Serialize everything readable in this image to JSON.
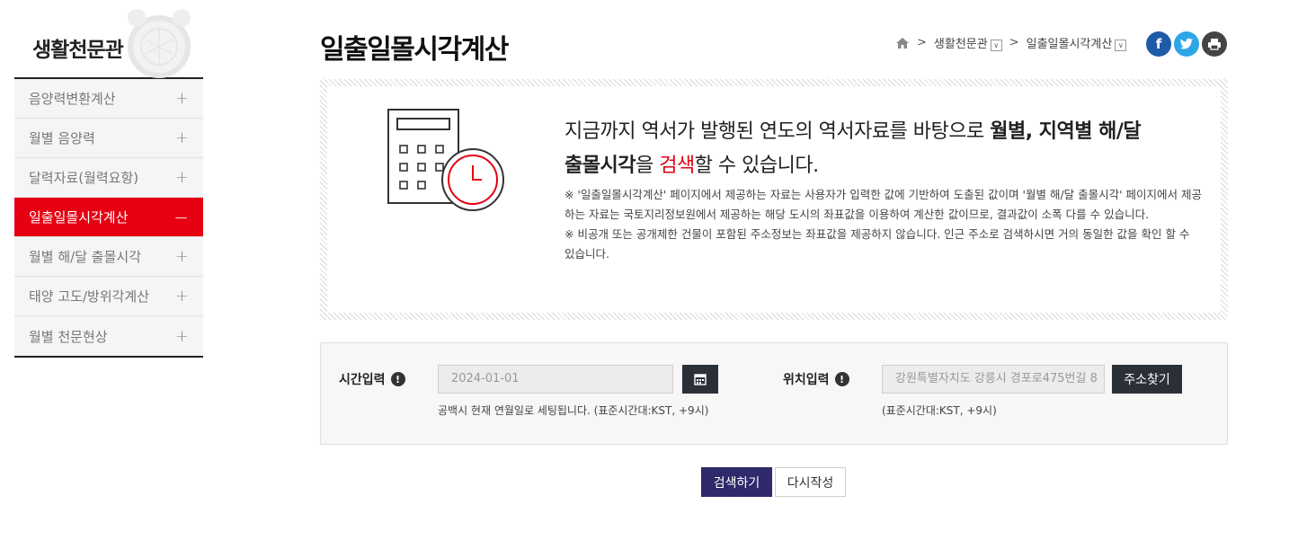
{
  "sidebar": {
    "title": "생활천문관",
    "items": [
      {
        "label": "음양력변환계산",
        "sign": "+"
      },
      {
        "label": "월별 음양력",
        "sign": "+"
      },
      {
        "label": "달력자료(월력요항)",
        "sign": "+"
      },
      {
        "label": "일출일몰시각계산",
        "sign": "−",
        "active": true
      },
      {
        "label": "월별 해/달 출몰시각",
        "sign": "+"
      },
      {
        "label": "태양 고도/방위각계산",
        "sign": "+"
      },
      {
        "label": "월별 천문현상",
        "sign": "+"
      }
    ]
  },
  "header": {
    "title": "일출일몰시각계산",
    "breadcrumb": [
      "생활천문관",
      "일출일몰시각계산"
    ],
    "social": [
      "f",
      "t",
      "print"
    ]
  },
  "info": {
    "lead_1": "지금까지 역서가 발행된 연도의 역서자료를 바탕으로 ",
    "lead_bold_1": "월별, 지역별 해/달",
    "lead_bold_2": "출몰시각",
    "lead_2": "을 ",
    "lead_red": "검색",
    "lead_3": "할 수 있습니다.",
    "note_1": "※ '일출일몰시각계산' 페이지에서 제공하는 자료는 사용자가 입력한 값에 기반하여 도출된 값이며 '월별 해/달 출몰시각' 페이지에서 제공하는 자료는 국토지리정보원에서 제공하는 해당 도시의 좌표값을 이용하여 계산한 값이므로, 결과값이 소폭 다를 수 있습니다.",
    "note_2": "※ 비공개 또는 공개제한 건물이 포함된 주소정보는 좌표값을 제공하지 않습니다. 인근 주소로 검색하시면 거의 동일한 값을 확인 할 수 있습니다."
  },
  "form": {
    "time_label": "시간입력",
    "time_value": "2024-01-01",
    "time_hint": "공백시 현재 연월일로 세팅됩니다. (표준시간대:KST, +9시)",
    "location_label": "위치입력",
    "location_value": "강원특별자치도 강릉시 경포로475번길 8",
    "location_hint": "(표준시간대:KST, +9시)",
    "address_button": "주소찾기"
  },
  "actions": {
    "search": "검색하기",
    "reset": "다시작성"
  },
  "colors": {
    "accent_red": "#e60012",
    "search_button": "#2e2a6b",
    "dark_button": "#2b3038"
  }
}
